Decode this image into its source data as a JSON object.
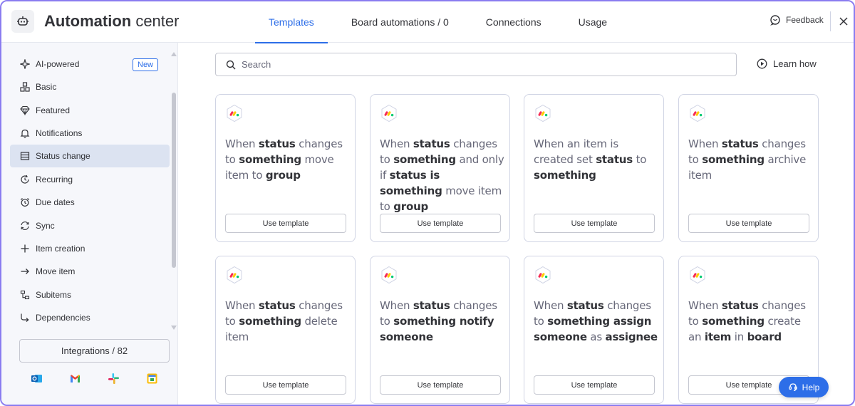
{
  "header": {
    "title_bold": "Automation",
    "title_rest": " center",
    "tabs": [
      {
        "label": "Templates",
        "active": true
      },
      {
        "label": "Board automations / 0",
        "active": false
      },
      {
        "label": "Connections",
        "active": false
      },
      {
        "label": "Usage",
        "active": false
      }
    ],
    "feedback_label": "Feedback"
  },
  "sidebar": {
    "items": [
      {
        "label": "AI-powered",
        "icon": "sparkle-icon",
        "badge": "New"
      },
      {
        "label": "Basic",
        "icon": "blocks-icon"
      },
      {
        "label": "Featured",
        "icon": "diamond-icon"
      },
      {
        "label": "Notifications",
        "icon": "bell-icon"
      },
      {
        "label": "Status change",
        "icon": "status-list-icon",
        "active": true
      },
      {
        "label": "Recurring",
        "icon": "recurring-icon"
      },
      {
        "label": "Due dates",
        "icon": "alarm-icon"
      },
      {
        "label": "Sync",
        "icon": "sync-icon"
      },
      {
        "label": "Item creation",
        "icon": "plus-icon"
      },
      {
        "label": "Move item",
        "icon": "arrow-right-icon"
      },
      {
        "label": "Subitems",
        "icon": "subitems-icon"
      },
      {
        "label": "Dependencies",
        "icon": "dependencies-icon"
      }
    ],
    "integrations_label": "Integrations / 82",
    "apps": [
      "outlook-icon",
      "gmail-icon",
      "slack-icon",
      "google-calendar-icon"
    ]
  },
  "search": {
    "placeholder": "Search"
  },
  "learn_how_label": "Learn how",
  "cards": [
    {
      "text": [
        [
          "When ",
          0
        ],
        [
          "status",
          1
        ],
        [
          " changes to ",
          0
        ],
        [
          "something",
          1
        ],
        [
          " move item to ",
          0
        ],
        [
          "group",
          1
        ]
      ],
      "button": "Use template"
    },
    {
      "text": [
        [
          "When ",
          0
        ],
        [
          "status",
          1
        ],
        [
          " changes to ",
          0
        ],
        [
          "something",
          1
        ],
        [
          " and only if ",
          0
        ],
        [
          "status is something",
          1
        ],
        [
          " move item to ",
          0
        ],
        [
          "group",
          1
        ]
      ],
      "button": "Use template"
    },
    {
      "text": [
        [
          "When an item is created set ",
          0
        ],
        [
          "status",
          1
        ],
        [
          " to ",
          0
        ],
        [
          "something",
          1
        ]
      ],
      "button": "Use template"
    },
    {
      "text": [
        [
          "When ",
          0
        ],
        [
          "status",
          1
        ],
        [
          " changes to ",
          0
        ],
        [
          "something",
          1
        ],
        [
          " archive item",
          0
        ]
      ],
      "button": "Use template"
    },
    {
      "text": [
        [
          "When ",
          0
        ],
        [
          "status",
          1
        ],
        [
          " changes to ",
          0
        ],
        [
          "something",
          1
        ],
        [
          " delete item",
          0
        ]
      ],
      "button": "Use template"
    },
    {
      "text": [
        [
          "When ",
          0
        ],
        [
          "status",
          1
        ],
        [
          " changes to ",
          0
        ],
        [
          "something notify someone",
          1
        ]
      ],
      "button": "Use template"
    },
    {
      "text": [
        [
          "When ",
          0
        ],
        [
          "status",
          1
        ],
        [
          " changes to ",
          0
        ],
        [
          "something assign someone",
          1
        ],
        [
          " as ",
          0
        ],
        [
          "assignee",
          1
        ]
      ],
      "button": "Use template"
    },
    {
      "text": [
        [
          "When ",
          0
        ],
        [
          "status",
          1
        ],
        [
          " changes to ",
          0
        ],
        [
          "something",
          1
        ],
        [
          " create an ",
          0
        ],
        [
          "item",
          1
        ],
        [
          " in ",
          0
        ],
        [
          "board",
          1
        ]
      ],
      "button": "Use template"
    }
  ],
  "help_label": "Help",
  "colors": {
    "accent": "#2d6ee8",
    "active_bg": "#dce3f1",
    "frame": "#8a7cf0"
  }
}
